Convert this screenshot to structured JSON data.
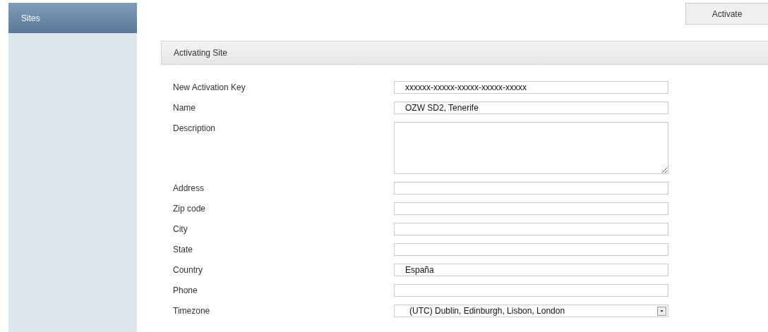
{
  "sidebar": {
    "items": [
      {
        "label": "Sites",
        "selected": true
      }
    ]
  },
  "toolbar": {
    "buttons": [
      "Activate"
    ]
  },
  "section": {
    "title": "Activating Site"
  },
  "fields": [
    {
      "label": "New Activation Key",
      "kind": "text",
      "value": "xxxxxx-xxxxx-xxxxx-xxxxx-xxxxx"
    },
    {
      "label": "Name",
      "kind": "text",
      "value": "OZW SD2, Tenerife"
    },
    {
      "label": "Description",
      "kind": "textarea"
    },
    {
      "label": "Address",
      "kind": "text"
    },
    {
      "label": "Zip code",
      "kind": "text"
    },
    {
      "label": "City",
      "kind": "text"
    },
    {
      "label": "State",
      "kind": "text"
    },
    {
      "label": "Country",
      "kind": "text",
      "value": "España"
    },
    {
      "label": "Phone",
      "kind": "text"
    },
    {
      "label": "Timezone",
      "kind": "select",
      "value": "(UTC) Dublin, Edinburgh, Lisbon, London"
    }
  ]
}
